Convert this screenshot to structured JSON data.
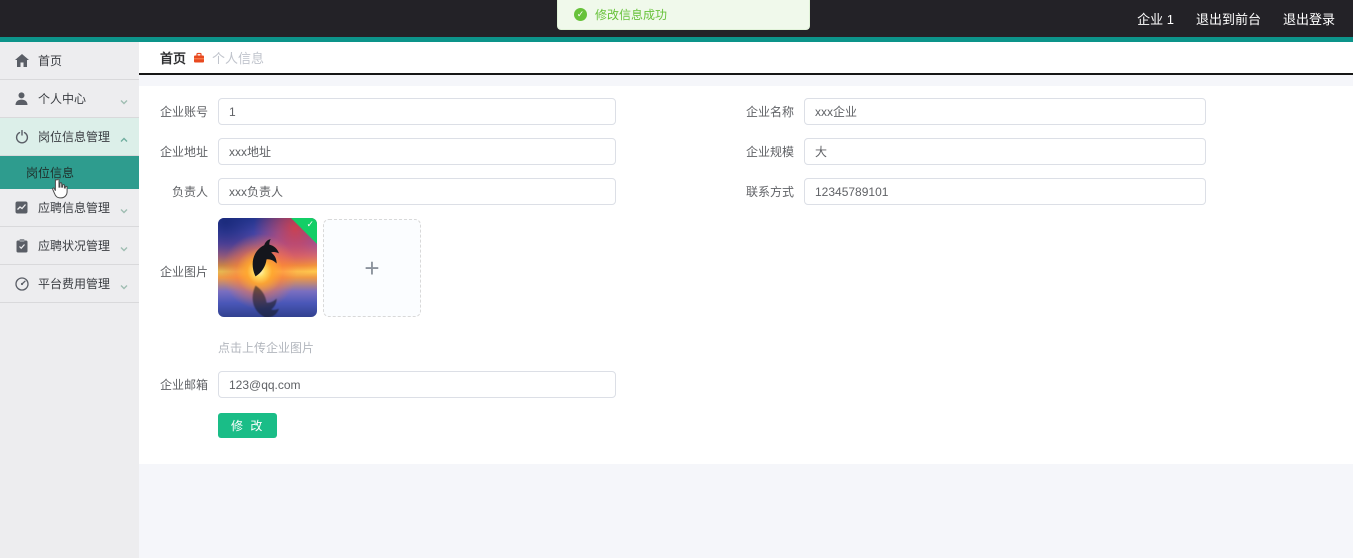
{
  "topbar": {
    "account_label": "企业 1",
    "exit_to_front": "退出到前台",
    "logout": "退出登录"
  },
  "toast": {
    "message": "修改信息成功"
  },
  "sidebar": {
    "items": [
      {
        "label": "首页",
        "icon": "home-icon"
      },
      {
        "label": "个人中心",
        "icon": "user-icon",
        "chevron": "down"
      },
      {
        "label": "岗位信息管理",
        "icon": "power-icon",
        "chevron": "up",
        "expanded": true
      },
      {
        "label": "应聘信息管理",
        "icon": "chart-icon",
        "chevron": "down"
      },
      {
        "label": "应聘状况管理",
        "icon": "clipboard-icon",
        "chevron": "down"
      },
      {
        "label": "平台费用管理",
        "icon": "gauge-icon",
        "chevron": "down"
      }
    ],
    "active_submenu": {
      "label": "岗位信息"
    }
  },
  "breadcrumb": {
    "home": "首页",
    "current": "个人信息"
  },
  "form": {
    "account": {
      "label": "企业账号",
      "value": "1"
    },
    "company_name": {
      "label": "企业名称",
      "value": "xxx企业"
    },
    "address": {
      "label": "企业地址",
      "value": "xxx地址"
    },
    "scale": {
      "label": "企业规模",
      "value": "大"
    },
    "manager": {
      "label": "负责人",
      "value": "xxx负责人"
    },
    "contact": {
      "label": "联系方式",
      "value": "12345789101"
    },
    "picture": {
      "label": "企业图片",
      "hint": "点击上传企业图片"
    },
    "email": {
      "label": "企业邮箱",
      "value": "123@qq.com"
    },
    "submit_label": "修 改"
  },
  "colors": {
    "accent_teal": "#0c948a",
    "active_menu": "#2e9c8e",
    "success_green": "#67c23a",
    "button_green": "#1abd87",
    "breadcrumb_icon": "#e8491f"
  }
}
